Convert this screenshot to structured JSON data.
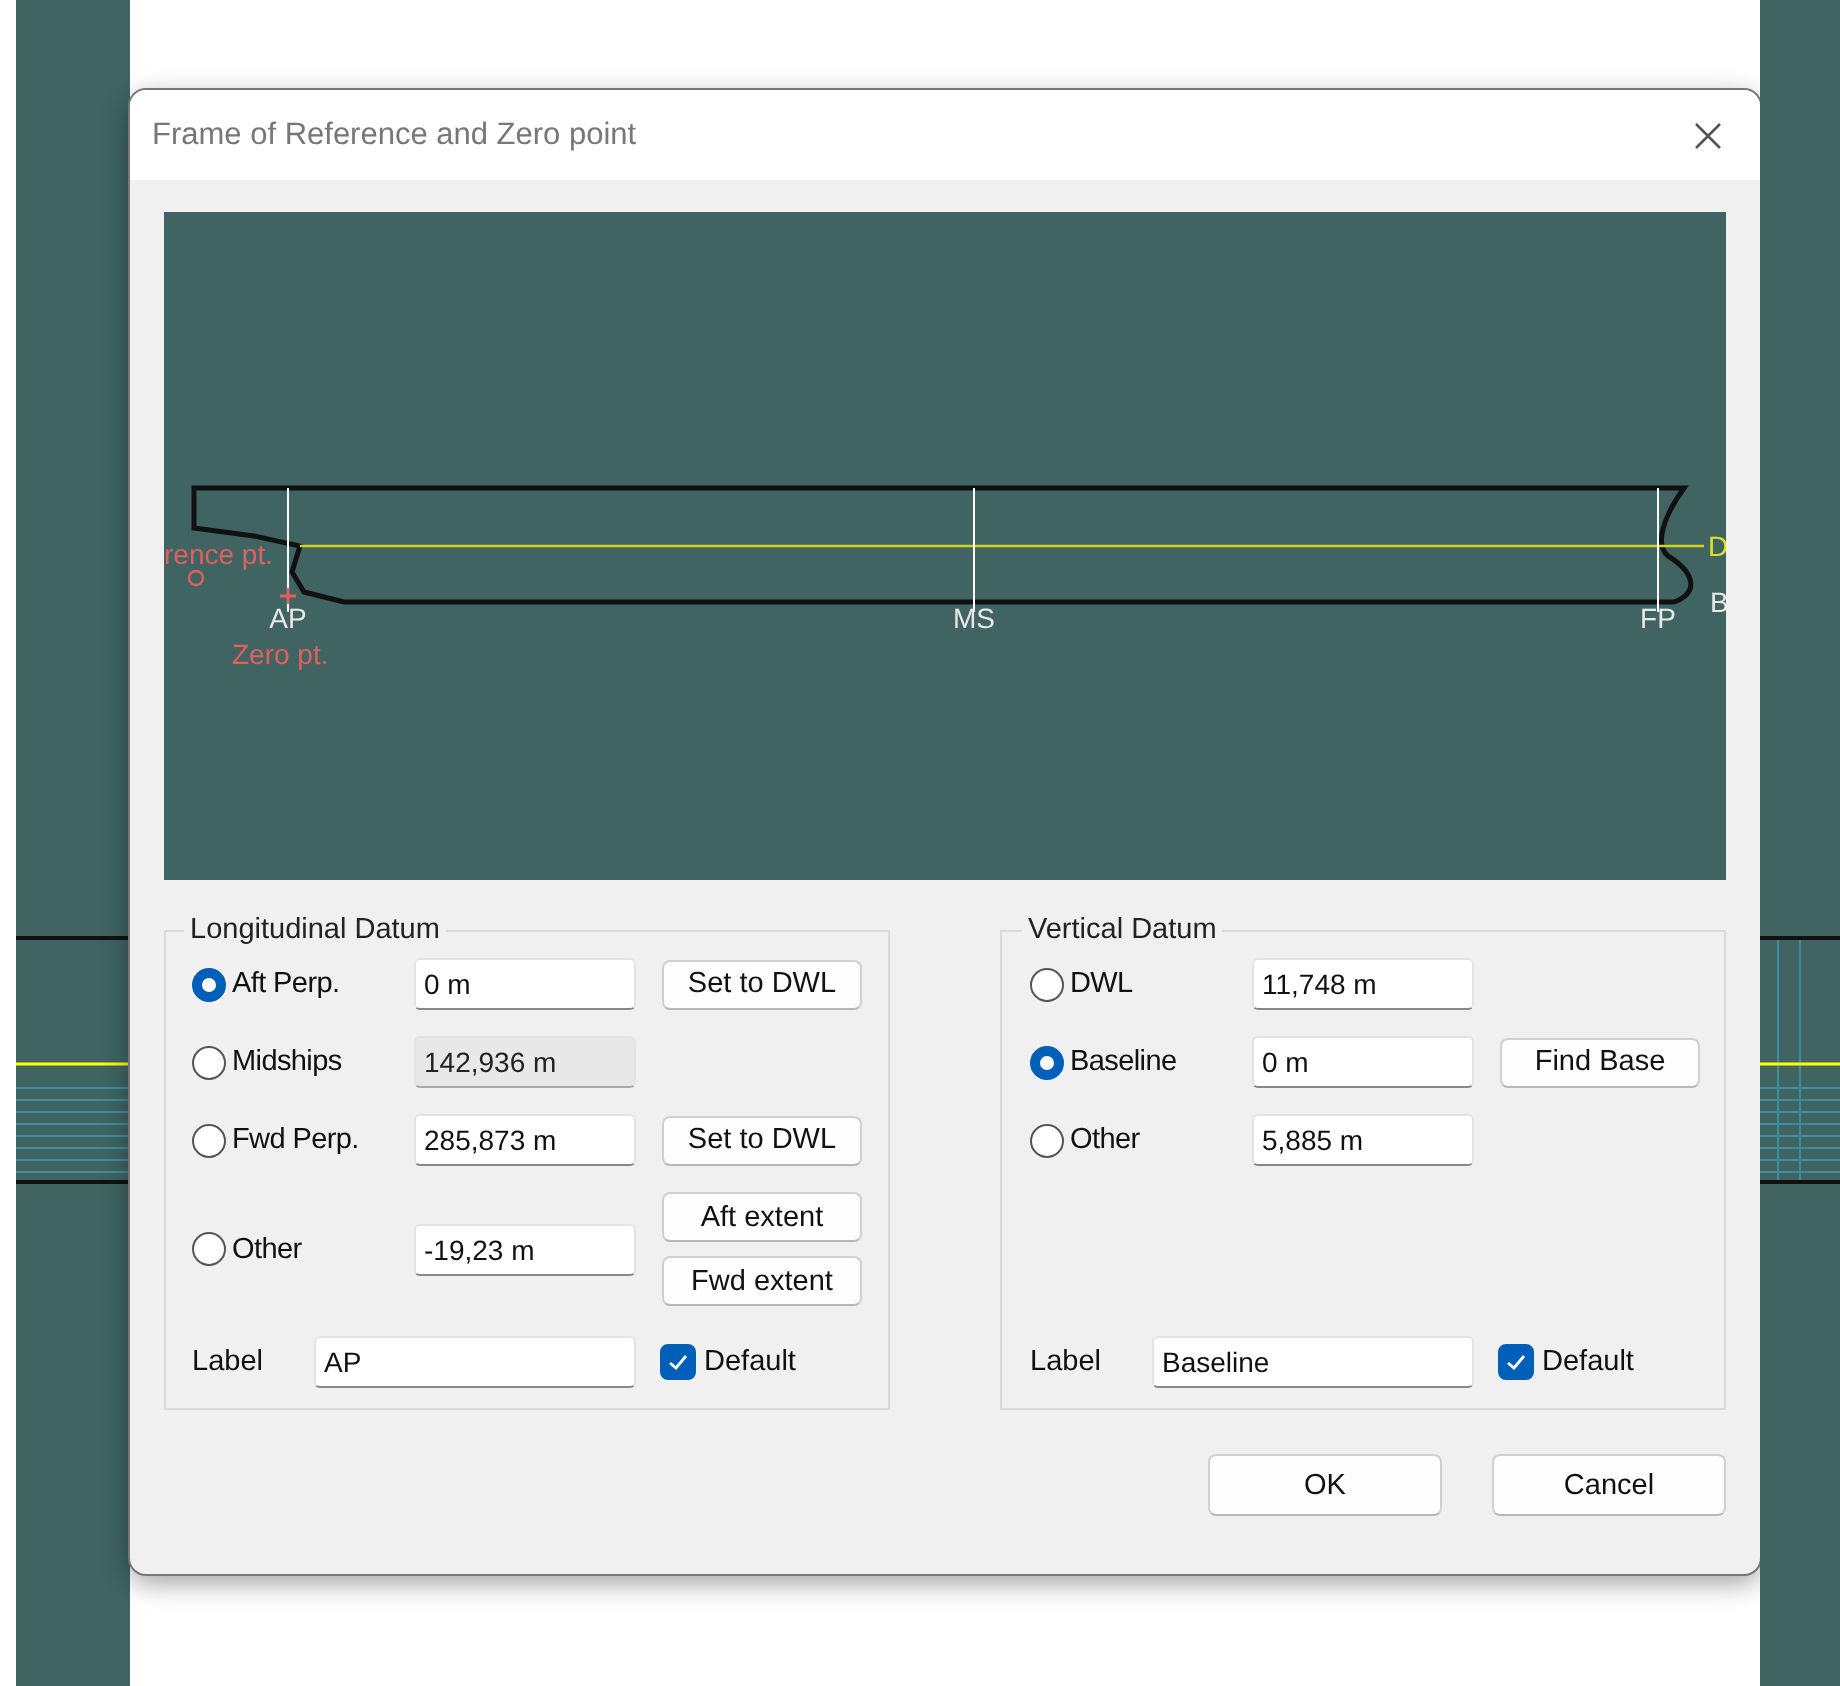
{
  "dialog": {
    "title": "Frame of Reference and Zero point"
  },
  "preview": {
    "reference_label": "rence pt.",
    "zero_label": "Zero pt.",
    "stations": [
      "AP",
      "MS",
      "FP"
    ],
    "datum_markers": [
      "D",
      "B"
    ]
  },
  "longitudinal": {
    "title": "Longitudinal Datum",
    "options": [
      {
        "label": "Aft Perp.",
        "selected": true,
        "value": "0 m",
        "disabled": false,
        "buttons": [
          "Set to DWL"
        ]
      },
      {
        "label": "Midships",
        "selected": false,
        "value": "142,936 m",
        "disabled": true
      },
      {
        "label": "Fwd Perp.",
        "selected": false,
        "value": "285,873 m",
        "disabled": false,
        "buttons": [
          "Set to DWL"
        ]
      },
      {
        "label": "Other",
        "selected": false,
        "value": "-19,23 m",
        "disabled": false,
        "buttons": [
          "Aft extent",
          "Fwd extent"
        ]
      }
    ],
    "label_caption": "Label",
    "label_value": "AP",
    "default": {
      "label": "Default",
      "checked": true
    }
  },
  "vertical": {
    "title": "Vertical Datum",
    "options": [
      {
        "label": "DWL",
        "selected": false,
        "value": "11,748 m",
        "disabled": false
      },
      {
        "label": "Baseline",
        "selected": true,
        "value": "0 m",
        "disabled": false,
        "buttons": [
          "Find Base"
        ]
      },
      {
        "label": "Other",
        "selected": false,
        "value": "5,885 m",
        "disabled": false
      }
    ],
    "label_caption": "Label",
    "label_value": "Baseline",
    "default": {
      "label": "Default",
      "checked": true
    }
  },
  "buttons": [
    "OK",
    "Cancel"
  ]
}
